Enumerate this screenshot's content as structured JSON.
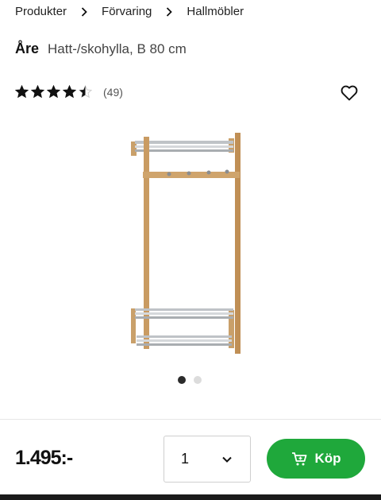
{
  "breadcrumb": [
    "Produkter",
    "Förvaring",
    "Hallmöbler"
  ],
  "product": {
    "brand": "Åre",
    "subtitle": "Hatt-/skohylla, B 80 cm",
    "rating": 4.5,
    "rating_max": 5,
    "review_count": "(49)",
    "image": "coat-and-shoe-rack-image"
  },
  "gallery": {
    "total": 2,
    "active": 1
  },
  "purchase": {
    "price": "1.495:-",
    "quantity": "1",
    "buy_label": "Köp"
  },
  "icons": {
    "breadcrumb_separator": "chevron-right-icon",
    "favorite": "heart-icon",
    "quantity_dropdown": "chevron-down-icon",
    "buy": "cart-icon"
  },
  "colors": {
    "buy_button": "#1fa83b",
    "active_dot": "#2b2b2b",
    "inactive_dot": "#dcdcdc",
    "star": "#111111"
  }
}
